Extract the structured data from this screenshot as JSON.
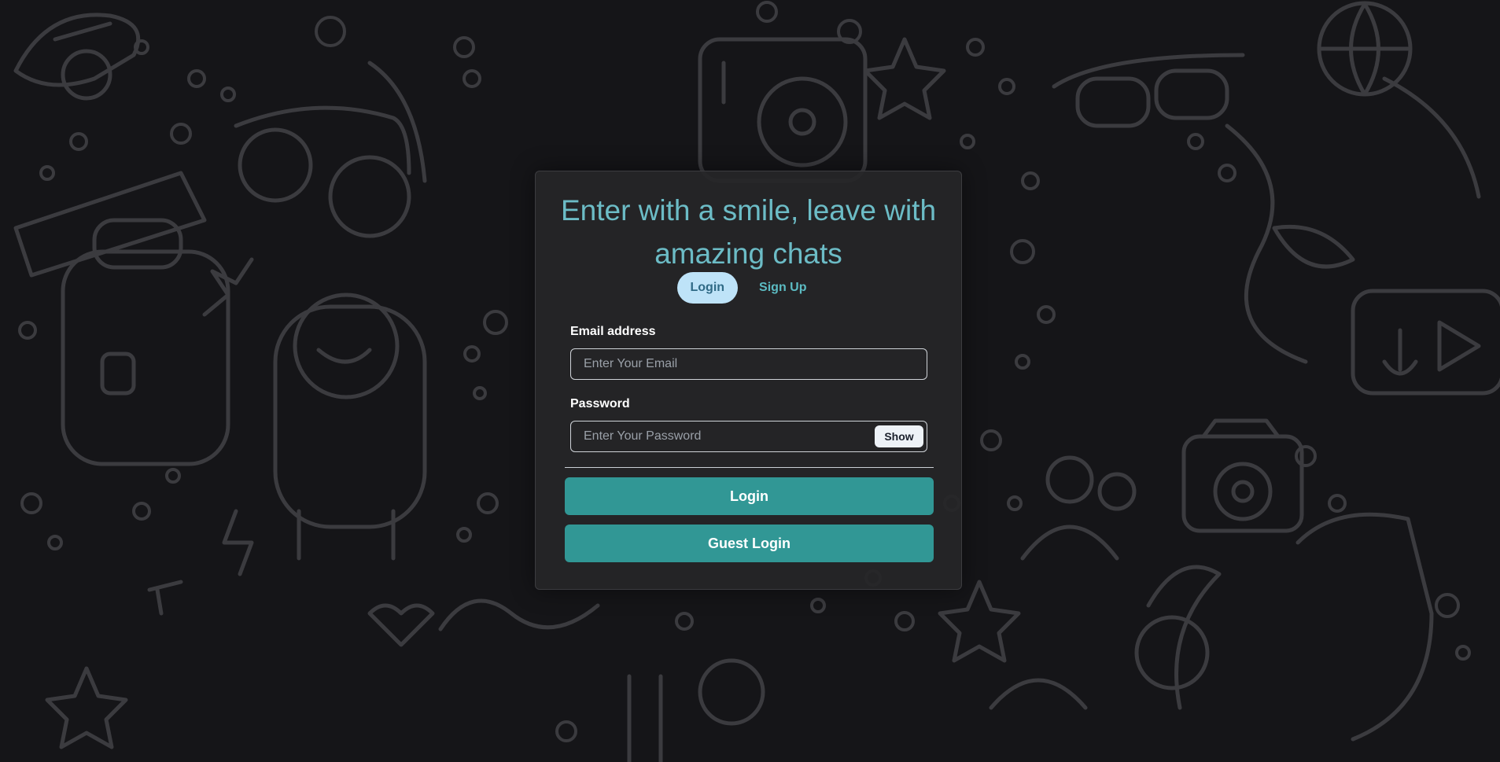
{
  "theme": {
    "accent": "#319795",
    "title_color": "#6cbcc6",
    "active_tab_bg": "#bee3f8"
  },
  "background": {
    "icon": "doodle-pattern"
  },
  "card": {
    "title": "Enter with a smile, leave with amazing chats",
    "tabs": [
      {
        "label": "Login",
        "active": true
      },
      {
        "label": "Sign Up",
        "active": false
      }
    ],
    "email": {
      "label": "Email address",
      "placeholder": "Enter Your Email",
      "value": ""
    },
    "password": {
      "label": "Password",
      "placeholder": "Enter Your Password",
      "value": "",
      "toggle_label": "Show"
    },
    "login_button": "Login",
    "guest_button": "Guest Login"
  }
}
